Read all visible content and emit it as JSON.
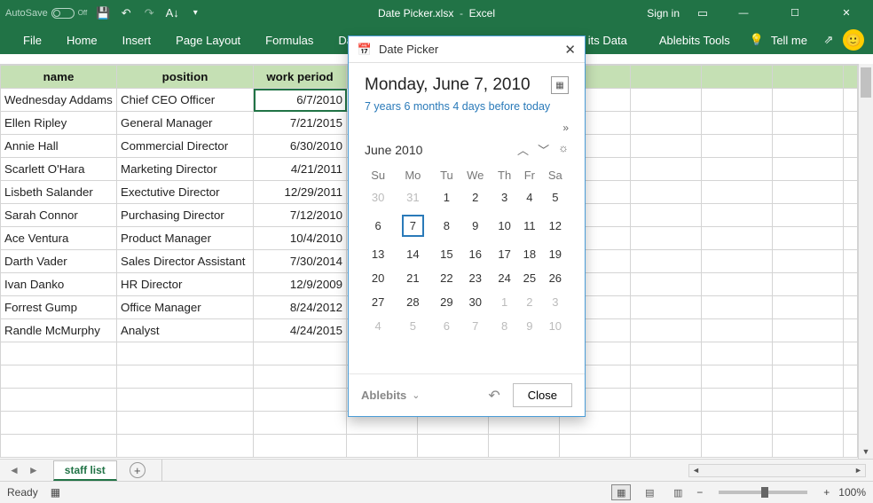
{
  "window": {
    "autosave_label": "AutoSave",
    "autosave_state": "Off",
    "title_file": "Date Picker.xlsx",
    "title_app": "Excel",
    "signin": "Sign in"
  },
  "ribbon": {
    "tabs": [
      "File",
      "Home",
      "Insert",
      "Page Layout",
      "Formulas",
      "Data"
    ],
    "right_tabs": [
      "its Data",
      "Ablebits Tools"
    ],
    "tell_me": "Tell me"
  },
  "headers": {
    "c0": "name",
    "c1": "position",
    "c2": "work period"
  },
  "rows": [
    {
      "name": "Wednesday Addams",
      "position": "Chief CEO Officer",
      "date": "6/7/2010",
      "active": true
    },
    {
      "name": "Ellen Ripley",
      "position": "General Manager",
      "date": "7/21/2015"
    },
    {
      "name": "Annie Hall",
      "position": "Commercial Director",
      "date": "6/30/2010"
    },
    {
      "name": "Scarlett O'Hara",
      "position": "Marketing Director",
      "date": "4/21/2011"
    },
    {
      "name": "Lisbeth Salander",
      "position": "Exectutive Director",
      "date": "12/29/2011"
    },
    {
      "name": "Sarah Connor",
      "position": "Purchasing Director",
      "date": "7/12/2010"
    },
    {
      "name": "Ace Ventura",
      "position": "Product Manager",
      "date": "10/4/2010"
    },
    {
      "name": "Darth Vader",
      "position": "Sales Director Assistant",
      "date": "7/30/2014"
    },
    {
      "name": "Ivan Danko",
      "position": "HR Director",
      "date": "12/9/2009"
    },
    {
      "name": "Forrest Gump",
      "position": "Office Manager",
      "date": "8/24/2012"
    },
    {
      "name": "Randle McMurphy",
      "position": "Analyst",
      "date": "4/24/2015"
    }
  ],
  "sheet_tab": "staff list",
  "status": {
    "ready": "Ready",
    "zoom": "100%"
  },
  "picker": {
    "title": "Date Picker",
    "big_date": "Monday, June 7, 2010",
    "diff": "7 years 6 months 4 days before today",
    "month_label": "June 2010",
    "dow": [
      "Su",
      "Mo",
      "Tu",
      "We",
      "Th",
      "Fr",
      "Sa"
    ],
    "weeks": [
      [
        {
          "d": "30",
          "off": true
        },
        {
          "d": "31",
          "off": true
        },
        {
          "d": "1"
        },
        {
          "d": "2"
        },
        {
          "d": "3"
        },
        {
          "d": "4"
        },
        {
          "d": "5"
        }
      ],
      [
        {
          "d": "6"
        },
        {
          "d": "7",
          "sel": true
        },
        {
          "d": "8"
        },
        {
          "d": "9"
        },
        {
          "d": "10"
        },
        {
          "d": "11"
        },
        {
          "d": "12"
        }
      ],
      [
        {
          "d": "13"
        },
        {
          "d": "14"
        },
        {
          "d": "15"
        },
        {
          "d": "16"
        },
        {
          "d": "17"
        },
        {
          "d": "18"
        },
        {
          "d": "19"
        }
      ],
      [
        {
          "d": "20"
        },
        {
          "d": "21"
        },
        {
          "d": "22"
        },
        {
          "d": "23"
        },
        {
          "d": "24"
        },
        {
          "d": "25"
        },
        {
          "d": "26"
        }
      ],
      [
        {
          "d": "27"
        },
        {
          "d": "28"
        },
        {
          "d": "29"
        },
        {
          "d": "30"
        },
        {
          "d": "1",
          "off": true
        },
        {
          "d": "2",
          "off": true
        },
        {
          "d": "3",
          "off": true
        }
      ],
      [
        {
          "d": "4",
          "off": true
        },
        {
          "d": "5",
          "off": true
        },
        {
          "d": "6",
          "off": true
        },
        {
          "d": "7",
          "off": true
        },
        {
          "d": "8",
          "off": true
        },
        {
          "d": "9",
          "off": true
        },
        {
          "d": "10",
          "off": true
        }
      ]
    ],
    "brand": "Ablebits",
    "close": "Close"
  }
}
